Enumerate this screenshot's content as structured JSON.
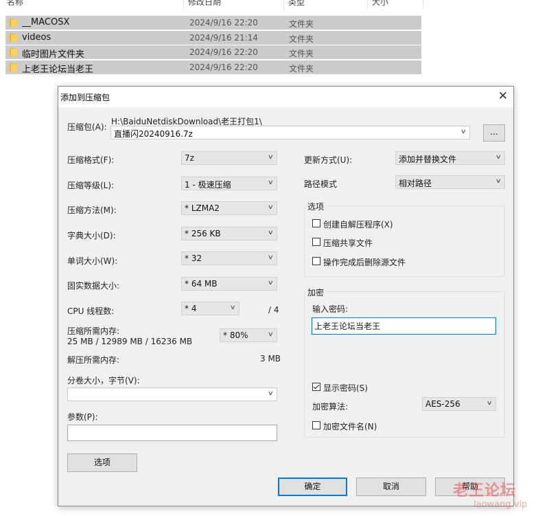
{
  "explorer": {
    "columns": {
      "name": "名称",
      "modified": "修改日期",
      "type": "类型",
      "size": "大小"
    },
    "rows": [
      {
        "name": "__MACOSX",
        "date": "2024/9/16 22:20",
        "type": "文件夹"
      },
      {
        "name": "videos",
        "date": "2024/9/16 21:14",
        "type": "文件夹"
      },
      {
        "name": "临时图片文件夹",
        "date": "2024/9/16 22:20",
        "type": "文件夹"
      },
      {
        "name": "上老王论坛当老王",
        "date": "2024/9/16 22:20",
        "type": "文件夹"
      }
    ]
  },
  "dialog": {
    "title": "添加到压缩包",
    "close_glyph": "✕",
    "archive_label": "压缩包(A):",
    "archive_path": "H:\\BaiduNetdiskDownload\\老王打包1\\",
    "archive_name": "直播闪20240916.7z",
    "browse_label": "...",
    "format_label": "压缩格式(F):",
    "format_value": "7z",
    "level_label": "压缩等级(L):",
    "level_value": "1 - 极速压缩",
    "method_label": "压缩方法(M):",
    "method_value": "* LZMA2",
    "dict_label": "字典大小(D):",
    "dict_value": "* 256 KB",
    "word_label": "单词大小(W):",
    "word_value": "* 32",
    "solid_label": "固实数据大小:",
    "solid_value": "* 64 MB",
    "threads_label": "CPU 线程数:",
    "threads_value": "* 4",
    "threads_max": "/ 4",
    "mem_comp_label": "压缩所需内存:",
    "mem_comp_value": "25 MB / 12989 MB / 16236 MB",
    "mem_percent": "* 80%",
    "mem_decomp_label": "解压所需内存:",
    "mem_decomp_value": "3 MB",
    "split_label": "分卷大小，字节(V):",
    "split_value": "",
    "params_label": "参数(P):",
    "params_value": "",
    "options_button": "选项",
    "update_label": "更新方式(U):",
    "update_value": "添加并替换文件",
    "pathmode_label": "路径模式",
    "pathmode_value": "相对路径",
    "options_group": {
      "title": "选项",
      "sfx": "创建自解压程序(X)",
      "shared": "压缩共享文件",
      "delete_after": "操作完成后删除源文件"
    },
    "encryption": {
      "title": "加密",
      "password_label": "输入密码:",
      "password_value": "上老王论坛当老王",
      "show_password": "显示密码(S)",
      "method_label": "加密算法:",
      "method_value": "AES-256",
      "encrypt_names": "加密文件名(N)"
    },
    "ok": "确定",
    "cancel": "取消",
    "help": "帮助"
  },
  "watermark": {
    "line1": "老王论坛",
    "line2": "laowang.vip"
  },
  "icons": {
    "folder": "folder-icon",
    "dropdown": "chevron-down-icon",
    "close": "close-icon",
    "checkbox": "checkbox-icon"
  }
}
